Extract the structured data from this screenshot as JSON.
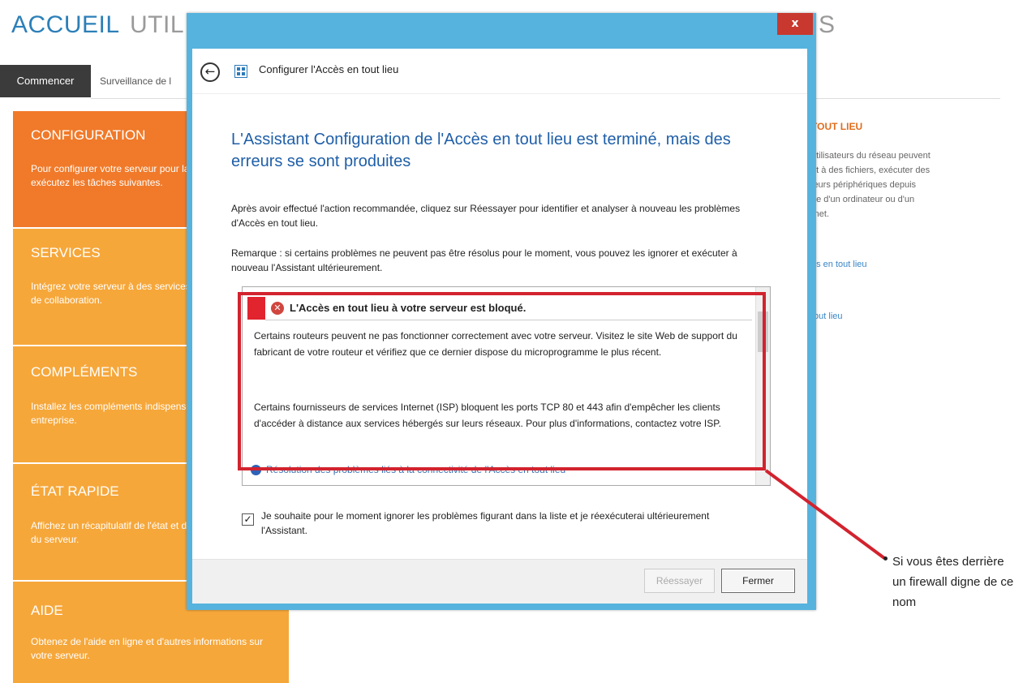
{
  "top_nav": {
    "home": "ACCUEIL",
    "users_partial": "UTIL",
    "right_partial": "S"
  },
  "subtabs": {
    "active": "Commencer",
    "next": "Surveillance de l"
  },
  "tiles": [
    {
      "title": "CONFIGURATION",
      "desc": "Pour configurer votre serveur pour la première fois, exécutez les tâches suivantes."
    },
    {
      "title": "SERVICES",
      "desc": "Intégrez votre serveur à des services de productivité et de collaboration."
    },
    {
      "title": "COMPLÉMENTS",
      "desc": "Installez les compléments indispensables à votre entreprise."
    },
    {
      "title": "ÉTAT RAPIDE",
      "desc": "Affichez un récapitulatif de l'état et de la configuration du serveur."
    },
    {
      "title": "AIDE",
      "desc": "Obtenez de l'aide en ligne et d'autres informations sur votre serveur."
    }
  ],
  "right_panel": {
    "title": "TOUT LIEU",
    "lines": [
      "utilisateurs du réseau peuvent",
      "nt à des fichiers, exécuter des",
      "leurs périphériques depuis",
      "de d'un ordinateur ou d'un",
      "rnet."
    ],
    "link1": "ès en tout lieu",
    "link2": "tout lieu"
  },
  "dialog": {
    "close_glyph": "x",
    "back_glyph": "←",
    "title": "Configurer l'Accès en tout lieu",
    "heading": "L'Assistant Configuration de l'Accès en tout lieu est terminé, mais des erreurs se sont produites",
    "para1": "Après avoir effectué l'action recommandée, cliquez sur Réessayer pour identifier et analyser à nouveau les problèmes d'Accès en tout lieu.",
    "para2": "Remarque : si certains problèmes ne peuvent pas être résolus pour le moment, vous pouvez les ignorer et exécuter à nouveau l'Assistant ultérieurement.",
    "issue": {
      "error_glyph": "✕",
      "title": "L'Accès en tout lieu à votre serveur est bloqué.",
      "p1": "Certains routeurs peuvent ne pas fonctionner correctement avec votre serveur. Visitez le site Web de support du fabricant de votre routeur et vérifiez que ce dernier dispose du microprogramme le plus récent.",
      "p2": "Certains fournisseurs de services Internet (ISP) bloquent les ports TCP 80 et 443 afin d'empêcher les clients d'accéder à distance aux services hébergés sur leurs réseaux. Pour plus d'informations, contactez votre ISP.",
      "link": "Résolution des problèmes liés à la connectivité de l'Accès en tout lieu"
    },
    "checkbox_checked": true,
    "checkbox_glyph": "✓",
    "checkbox_label": "Je souhaite pour le moment ignorer les problèmes figurant dans la liste et je réexécuterai ultérieurement l'Assistant.",
    "retry_label": "Réessayer",
    "close_label": "Fermer"
  },
  "annotation": {
    "text": "Si vous êtes derrière un firewall digne de ce nom",
    "color": "#d2232e"
  }
}
